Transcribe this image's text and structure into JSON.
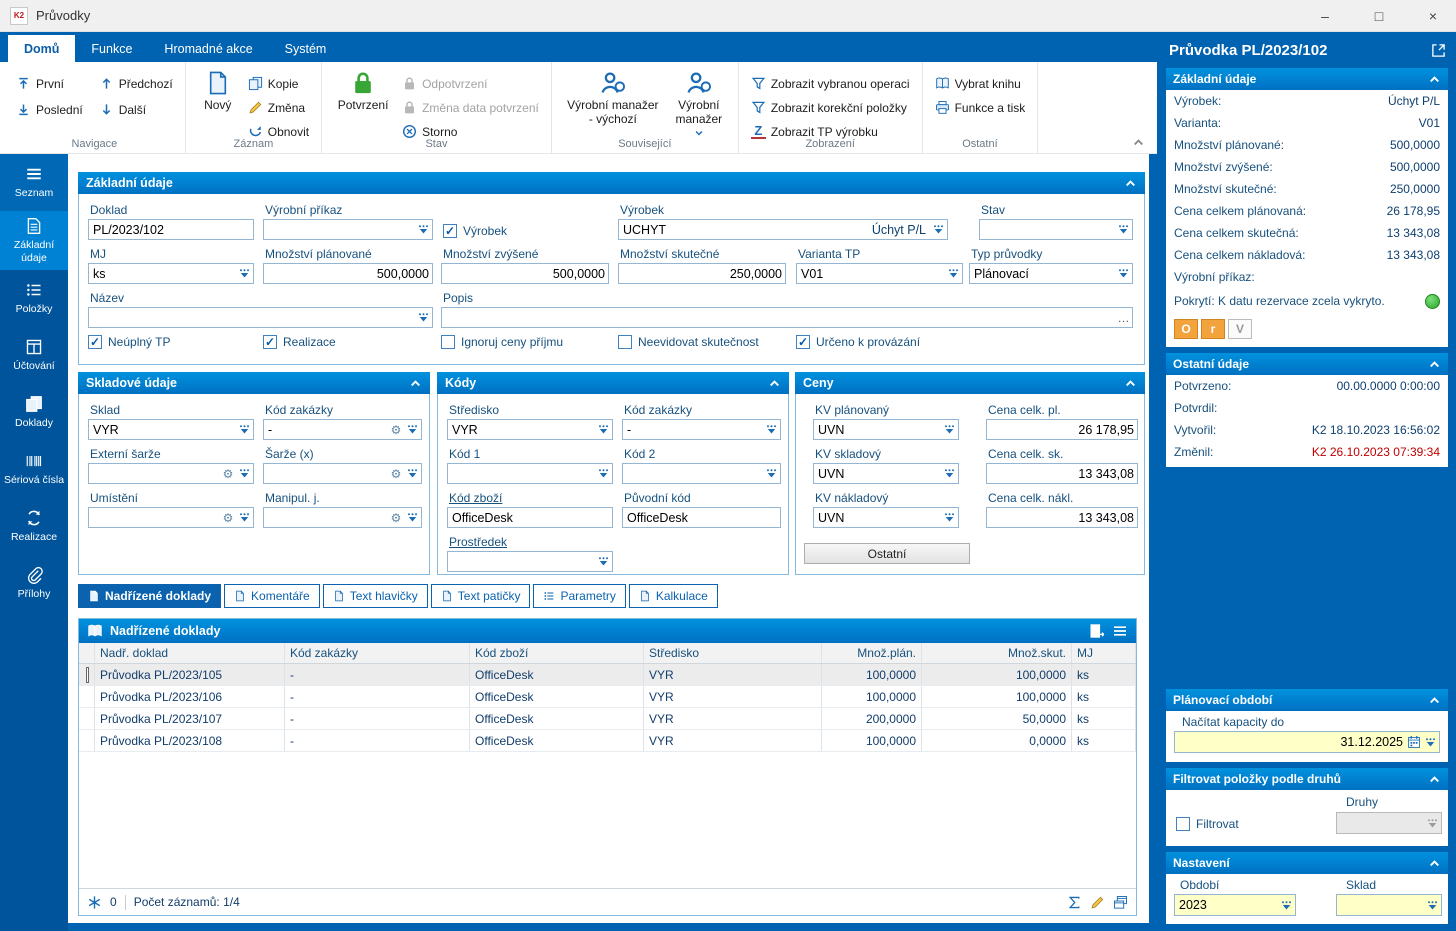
{
  "colors": {
    "accent_blue": "#0063b1",
    "section_header_blue": "#0082d4",
    "sidebar_blue": "#00549c",
    "mandatory_field_yellow": "#ffffc8",
    "coverage_green": "#2eb82e",
    "changed_red": "#c00000",
    "panel_button_orange": "#f2a33c"
  },
  "titlebar": {
    "title": "Průvodky"
  },
  "ribbon": {
    "tabs": [
      {
        "label": "Domů",
        "active": true
      },
      {
        "label": "Funkce"
      },
      {
        "label": "Hromadné akce"
      },
      {
        "label": "Systém"
      }
    ],
    "nav": {
      "group": "Navigace",
      "first": "První",
      "prev": "Předchozí",
      "last": "Poslední",
      "next": "Další"
    },
    "record": {
      "group": "Záznam",
      "new": "Nový",
      "copy": "Kopie",
      "change": "Změna",
      "refresh": "Obnovit"
    },
    "state": {
      "group": "Stav",
      "confirm": "Potvrzení",
      "unconfirm": "Odpotvrzení",
      "change_date": "Změna data potvrzení",
      "cancel": "Storno"
    },
    "related": {
      "group": "Související",
      "manager_default": "Výrobní manažer - výchozí",
      "manager": "Výrobní manažer"
    },
    "view": {
      "group": "Zobrazení",
      "operation": "Zobrazit vybranou operaci",
      "corrections": "Zobrazit korekční položky",
      "tp": "Zobrazit TP výrobku"
    },
    "other": {
      "group": "Ostatní",
      "select_book": "Vybrat knihu",
      "print": "Funkce a tisk"
    }
  },
  "sidebar": {
    "items": [
      {
        "label": "Seznam"
      },
      {
        "label": "Základní údaje",
        "active": true
      },
      {
        "label": "Položky"
      },
      {
        "label": "Účtování"
      },
      {
        "label": "Doklady"
      },
      {
        "label": "Sériová čísla"
      },
      {
        "label": "Realizace"
      },
      {
        "label": "Přílohy"
      }
    ]
  },
  "basic": {
    "title": "Základní údaje",
    "doklad": {
      "label": "Doklad",
      "value": "PL/2023/102"
    },
    "vyrobni_prikaz": {
      "label": "Výrobní příkaz",
      "value": ""
    },
    "vyrobek_check": {
      "label": "Výrobek",
      "checked": true
    },
    "vyrobek": {
      "label": "Výrobek",
      "code": "UCHYT",
      "name": "Úchyt P/L"
    },
    "stav": {
      "label": "Stav",
      "value": ""
    },
    "mj": {
      "label": "MJ",
      "value": "ks"
    },
    "mn_plan": {
      "label": "Množství plánované",
      "value": "500,0000"
    },
    "mn_zvys": {
      "label": "Množství zvýšené",
      "value": "500,0000"
    },
    "mn_skut": {
      "label": "Množství skutečné",
      "value": "250,0000"
    },
    "varianta": {
      "label": "Varianta TP",
      "value": "V01"
    },
    "typ": {
      "label": "Typ průvodky",
      "value": "Plánovací"
    },
    "nazev": {
      "label": "Název",
      "value": ""
    },
    "popis": {
      "label": "Popis",
      "value": ""
    },
    "checks": [
      {
        "label": "Neúplný TP",
        "checked": true
      },
      {
        "label": "Realizace",
        "checked": true
      },
      {
        "label": "Ignoruj ceny příjmu",
        "checked": false
      },
      {
        "label": "Neevidovat skutečnost",
        "checked": false
      },
      {
        "label": "Určeno k provázání",
        "checked": true
      }
    ]
  },
  "stock": {
    "title": "Skladové údaje",
    "fields": [
      {
        "label": "Sklad",
        "value": "VYR"
      },
      {
        "label": "Kód zakázky",
        "value": "-"
      },
      {
        "label": "Externí šarže",
        "value": ""
      },
      {
        "label": "Šarže (x)",
        "value": ""
      },
      {
        "label": "Umístění",
        "value": ""
      },
      {
        "label": "Manipul. j.",
        "value": ""
      }
    ]
  },
  "codes": {
    "title": "Kódy",
    "fields": [
      {
        "label": "Středisko",
        "value": "VYR"
      },
      {
        "label": "Kód zakázky",
        "value": "-"
      },
      {
        "label": "Kód 1",
        "value": ""
      },
      {
        "label": "Kód 2",
        "value": ""
      },
      {
        "label": "Kód zboží",
        "value": "OfficeDesk"
      },
      {
        "label": "Původní kód",
        "value": "OfficeDesk"
      },
      {
        "label": "Prostředek",
        "value": ""
      }
    ]
  },
  "prices": {
    "title": "Ceny",
    "rows": [
      {
        "kv_label": "KV plánovaný",
        "kv": "UVN",
        "price_label": "Cena celk. pl.",
        "price": "26 178,95"
      },
      {
        "kv_label": "KV skladový",
        "kv": "UVN",
        "price_label": "Cena celk. sk.",
        "price": "13 343,08"
      },
      {
        "kv_label": "KV nákladový",
        "kv": "UVN",
        "price_label": "Cena celk. nákl.",
        "price": "13 343,08"
      }
    ],
    "other_button": "Ostatní"
  },
  "tabs": [
    {
      "label": "Nadřízené doklady",
      "active": true
    },
    {
      "label": "Komentáře"
    },
    {
      "label": "Text hlavičky"
    },
    {
      "label": "Text patičky"
    },
    {
      "label": "Parametry"
    },
    {
      "label": "Kalkulace"
    }
  ],
  "grid": {
    "title": "Nadřízené doklady",
    "columns": [
      "Nadř. doklad",
      "Kód zakázky",
      "Kód zboží",
      "Středisko",
      "Množ.plán.",
      "Množ.skut.",
      "MJ"
    ],
    "rows": [
      [
        "Průvodka PL/2023/105",
        "-",
        "OfficeDesk",
        "VYR",
        "100,0000",
        "100,0000",
        "ks"
      ],
      [
        "Průvodka PL/2023/106",
        "-",
        "OfficeDesk",
        "VYR",
        "100,0000",
        "100,0000",
        "ks"
      ],
      [
        "Průvodka PL/2023/107",
        "-",
        "OfficeDesk",
        "VYR",
        "200,0000",
        "50,0000",
        "ks"
      ],
      [
        "Průvodka PL/2023/108",
        "-",
        "OfficeDesk",
        "VYR",
        "100,0000",
        "0,0000",
        "ks"
      ]
    ],
    "status": {
      "counter": "0",
      "records": "Počet záznamů: 1/4"
    }
  },
  "panel": {
    "title": "Průvodka PL/2023/102",
    "basic": {
      "title": "Základní údaje",
      "rows": [
        {
          "label": "Výrobek:",
          "value": "Úchyt P/L"
        },
        {
          "label": "Varianta:",
          "value": "V01"
        },
        {
          "label": "Množství plánované:",
          "value": "500,0000"
        },
        {
          "label": "Množství zvýšené:",
          "value": "500,0000"
        },
        {
          "label": "Množství skutečné:",
          "value": "250,0000"
        },
        {
          "label": "Cena celkem plánovaná:",
          "value": "26 178,95"
        },
        {
          "label": "Cena celkem skutečná:",
          "value": "13 343,08"
        },
        {
          "label": "Cena celkem nákladová:",
          "value": "13 343,08"
        },
        {
          "label": "Výrobní příkaz:",
          "value": ""
        }
      ],
      "coverage": "Pokrytí: K datu rezervace zcela vykryto.",
      "buttons": [
        "O",
        "r",
        "V"
      ]
    },
    "other": {
      "title": "Ostatní údaje",
      "rows": [
        {
          "label": "Potvrzeno:",
          "value": "00.00.0000 0:00:00"
        },
        {
          "label": "Potvrdil:",
          "value": ""
        },
        {
          "label": "Vytvořil:",
          "value": "K2 18.10.2023 16:56:02"
        },
        {
          "label": "Změnil:",
          "value": "K2 26.10.2023 07:39:34"
        }
      ]
    },
    "period": {
      "title": "Plánovací období",
      "label": "Načítat kapacity do",
      "value": "31.12.2025"
    },
    "filter": {
      "title": "Filtrovat položky podle druhů",
      "check_label": "Filtrovat",
      "checked": false,
      "druhy_label": "Druhy"
    },
    "settings": {
      "title": "Nastavení",
      "obdobi_label": "Období",
      "obdobi": "2023",
      "sklad_label": "Sklad",
      "sklad": ""
    }
  }
}
